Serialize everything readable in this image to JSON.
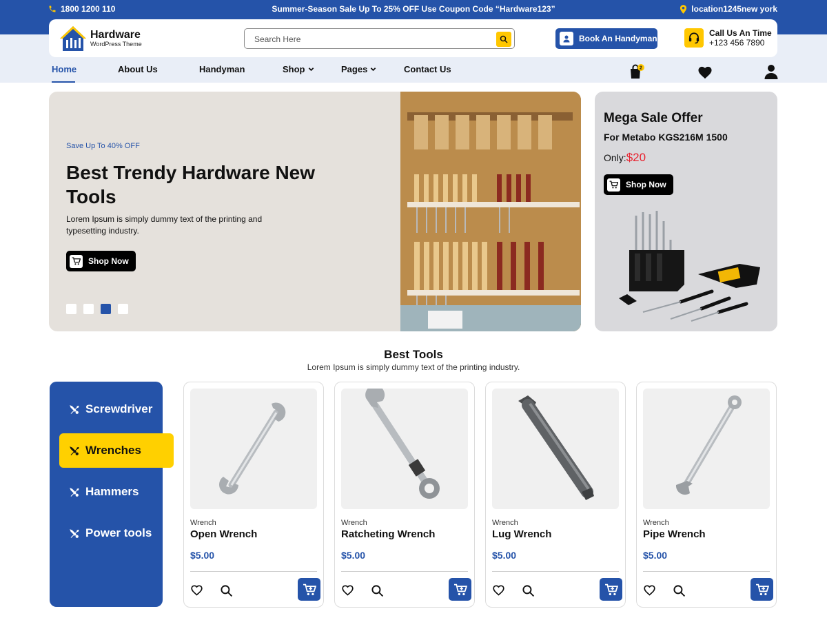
{
  "topbar": {
    "phone": "1800 1200 110",
    "promo": "Summer-Season Sale Up To 25% OFF Use Coupon Code  “Hardware123”",
    "location": "location1245new york"
  },
  "header": {
    "brand": "Hardware",
    "tagline": "WordPress Theme",
    "search_placeholder": "Search Here",
    "book_label": "Book An Handyman",
    "call_title": "Call Us An Time",
    "call_number": "+123 456 7890"
  },
  "nav": {
    "items": [
      {
        "label": "Home",
        "active": true
      },
      {
        "label": "About Us"
      },
      {
        "label": "Handyman"
      },
      {
        "label": "Shop"
      },
      {
        "label": "Pages"
      },
      {
        "label": "Contact Us"
      }
    ],
    "cart_count": "2"
  },
  "hero": {
    "kicker": "Save Up To 40% OFF",
    "title": "Best Trendy Hardware New Tools",
    "description": "Lorem Ipsum is simply dummy text of the printing and typesetting industry.",
    "cta": "Shop Now",
    "slides": 4,
    "active_slide": 3
  },
  "offer": {
    "title": "Mega Sale Offer",
    "subtitle": "For Metabo KGS216M 1500",
    "only_label": "Only:",
    "price": "$20",
    "cta": "Shop Now"
  },
  "best_tools": {
    "title": "Best Tools",
    "subtitle": "Lorem Ipsum is simply dummy text of the printing industry."
  },
  "categories": [
    {
      "label": "Screwdriver"
    },
    {
      "label": "Wrenches",
      "active": true
    },
    {
      "label": "Hammers"
    },
    {
      "label": "Power tools"
    }
  ],
  "products": [
    {
      "category": "Wrench",
      "name": "Open Wrench",
      "price": "$5.00"
    },
    {
      "category": "Wrench",
      "name": "Ratcheting Wrench",
      "price": "$5.00"
    },
    {
      "category": "Wrench",
      "name": "Lug Wrench",
      "price": "$5.00"
    },
    {
      "category": "Wrench",
      "name": "Pipe Wrench",
      "price": "$5.00"
    }
  ],
  "colors": {
    "primary": "#2553a9",
    "accent": "#ffc700",
    "sale_red": "#e8212e"
  }
}
